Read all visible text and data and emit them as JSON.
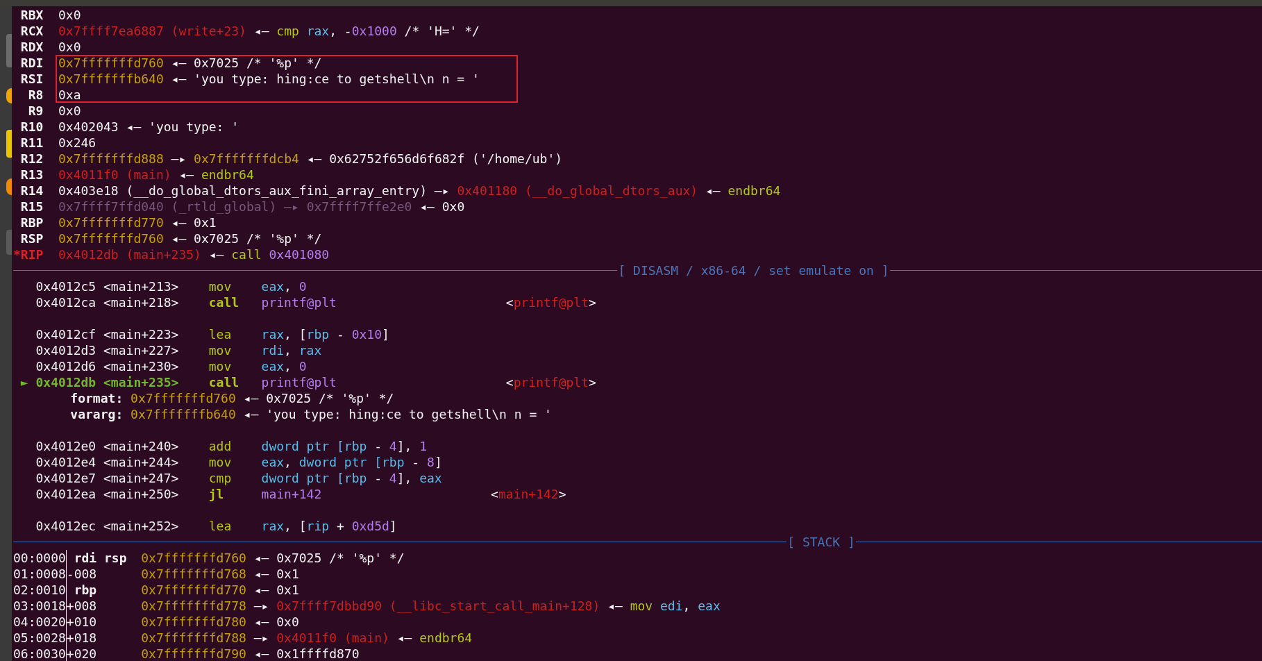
{
  "registers": [
    {
      "name": "RBX",
      "changed": false,
      "highlighted": false,
      "value": [
        {
          "text": "0x0",
          "kind": "plain"
        }
      ]
    },
    {
      "name": "RCX",
      "changed": false,
      "highlighted": false,
      "value": [
        {
          "text": "0x7ffff7ea6887 (write+23)",
          "kind": "code"
        },
        {
          "text": " ◂— ",
          "kind": "plain"
        },
        {
          "text": "cmp",
          "kind": "kw"
        },
        {
          "text": " rax",
          "kind": "reg"
        },
        {
          "text": ", -",
          "kind": "plain"
        },
        {
          "text": "0x1000",
          "kind": "num"
        },
        {
          "text": " /* 'H=' */",
          "kind": "plain"
        }
      ]
    },
    {
      "name": "RDX",
      "changed": false,
      "highlighted": false,
      "value": [
        {
          "text": "0x0",
          "kind": "plain"
        }
      ]
    },
    {
      "name": "RDI",
      "changed": false,
      "highlighted": true,
      "value": [
        {
          "text": "0x7fffffffd760",
          "kind": "stack"
        },
        {
          "text": " ◂— 0x7025 /* '%p' */",
          "kind": "plain"
        }
      ]
    },
    {
      "name": "RSI",
      "changed": false,
      "highlighted": true,
      "value": [
        {
          "text": "0x7fffffffb640",
          "kind": "stack"
        },
        {
          "text": " ◂— 'you type: hing:ce to getshell\\n n = '",
          "kind": "plain"
        }
      ]
    },
    {
      "name": "R8",
      "changed": false,
      "highlighted": true,
      "value": [
        {
          "text": "0xa",
          "kind": "plain"
        }
      ]
    },
    {
      "name": "R9",
      "changed": false,
      "highlighted": false,
      "value": [
        {
          "text": "0x0",
          "kind": "plain"
        }
      ]
    },
    {
      "name": "R10",
      "changed": false,
      "highlighted": false,
      "value": [
        {
          "text": "0x402043 ◂— 'you type: '",
          "kind": "plain"
        }
      ]
    },
    {
      "name": "R11",
      "changed": false,
      "highlighted": false,
      "value": [
        {
          "text": "0x246",
          "kind": "plain"
        }
      ]
    },
    {
      "name": "R12",
      "changed": false,
      "highlighted": false,
      "value": [
        {
          "text": "0x7fffffffd888",
          "kind": "stack"
        },
        {
          "text": " —▸ ",
          "kind": "plain"
        },
        {
          "text": "0x7fffffffdcb4",
          "kind": "stack"
        },
        {
          "text": " ◂— 0x62752f656d6f682f ('/home/ub')",
          "kind": "plain"
        }
      ]
    },
    {
      "name": "R13",
      "changed": false,
      "highlighted": false,
      "value": [
        {
          "text": "0x4011f0 (main)",
          "kind": "code"
        },
        {
          "text": " ◂— ",
          "kind": "plain"
        },
        {
          "text": "endbr64",
          "kind": "kw"
        }
      ]
    },
    {
      "name": "R14",
      "changed": false,
      "highlighted": false,
      "value": [
        {
          "text": "0x403e18 (__do_global_dtors_aux_fini_array_entry) —▸ ",
          "kind": "plain"
        },
        {
          "text": "0x401180 (__do_global_dtors_aux)",
          "kind": "code"
        },
        {
          "text": " ◂— ",
          "kind": "plain"
        },
        {
          "text": "endbr64",
          "kind": "kw"
        }
      ]
    },
    {
      "name": "R15",
      "changed": false,
      "highlighted": false,
      "value": [
        {
          "text": "0x7ffff7ffd040 (_rtld_global) —▸ 0x7ffff7ffe2e0",
          "kind": "dim"
        },
        {
          "text": " ◂— 0x0",
          "kind": "plain"
        }
      ]
    },
    {
      "name": "RBP",
      "changed": false,
      "highlighted": false,
      "value": [
        {
          "text": "0x7fffffffd770",
          "kind": "stack"
        },
        {
          "text": " ◂— 0x1",
          "kind": "plain"
        }
      ]
    },
    {
      "name": "RSP",
      "changed": false,
      "highlighted": false,
      "value": [
        {
          "text": "0x7fffffffd760",
          "kind": "stack"
        },
        {
          "text": " ◂— 0x7025 /* '%p' */",
          "kind": "plain"
        }
      ]
    },
    {
      "name": "*RIP",
      "changed": true,
      "highlighted": false,
      "value": [
        {
          "text": "0x4012db (main+235)",
          "kind": "code"
        },
        {
          "text": " ◂— ",
          "kind": "plain"
        },
        {
          "text": "call",
          "kind": "kw"
        },
        {
          "text": " 0x401080",
          "kind": "num"
        }
      ]
    }
  ],
  "disasm_header": "[ DISASM / x86-64 / set emulate on ]",
  "disasm": [
    {
      "kind": "insn",
      "current": false,
      "address": "0x4012c5",
      "symbol": "<main+213>",
      "mnemonic": "mov",
      "branch": false,
      "operands": [
        {
          "text": "eax",
          "kind": "reg"
        },
        {
          "text": ", ",
          "kind": "plain"
        },
        {
          "text": "0",
          "kind": "num"
        }
      ]
    },
    {
      "kind": "insn",
      "current": false,
      "address": "0x4012ca",
      "symbol": "<main+218>",
      "mnemonic": "call",
      "branch": true,
      "operands": [
        {
          "text": "printf@plt",
          "kind": "num"
        }
      ],
      "target": [
        {
          "text": "<",
          "kind": "plain"
        },
        {
          "text": "printf@plt",
          "kind": "code"
        },
        {
          "text": ">",
          "kind": "plain"
        }
      ]
    },
    {
      "kind": "blank"
    },
    {
      "kind": "insn",
      "current": false,
      "address": "0x4012cf",
      "symbol": "<main+223>",
      "mnemonic": "lea",
      "branch": false,
      "operands": [
        {
          "text": "rax",
          "kind": "reg"
        },
        {
          "text": ", [",
          "kind": "plain"
        },
        {
          "text": "rbp",
          "kind": "reg"
        },
        {
          "text": " - ",
          "kind": "plain"
        },
        {
          "text": "0x10",
          "kind": "num"
        },
        {
          "text": "]",
          "kind": "plain"
        }
      ]
    },
    {
      "kind": "insn",
      "current": false,
      "address": "0x4012d3",
      "symbol": "<main+227>",
      "mnemonic": "mov",
      "branch": false,
      "operands": [
        {
          "text": "rdi",
          "kind": "reg"
        },
        {
          "text": ", ",
          "kind": "plain"
        },
        {
          "text": "rax",
          "kind": "reg"
        }
      ]
    },
    {
      "kind": "insn",
      "current": false,
      "address": "0x4012d6",
      "symbol": "<main+230>",
      "mnemonic": "mov",
      "branch": false,
      "operands": [
        {
          "text": "eax",
          "kind": "reg"
        },
        {
          "text": ", ",
          "kind": "plain"
        },
        {
          "text": "0",
          "kind": "num"
        }
      ]
    },
    {
      "kind": "insn",
      "current": true,
      "pointer": "►",
      "address": "0x4012db",
      "symbol": "<main+235>",
      "mnemonic": "call",
      "branch": true,
      "operands": [
        {
          "text": "printf@plt",
          "kind": "num"
        }
      ],
      "target": [
        {
          "text": "<",
          "kind": "plain"
        },
        {
          "text": "printf@plt",
          "kind": "code"
        },
        {
          "text": ">",
          "kind": "plain"
        }
      ]
    },
    {
      "kind": "arg",
      "label": "format:",
      "value": [
        {
          "text": "0x7fffffffd760",
          "kind": "stack"
        },
        {
          "text": " ◂— 0x7025 /* '%p' */",
          "kind": "plain"
        }
      ]
    },
    {
      "kind": "arg",
      "label": "vararg:",
      "value": [
        {
          "text": "0x7fffffffb640",
          "kind": "stack"
        },
        {
          "text": " ◂— 'you type: hing:ce to getshell\\n n = '",
          "kind": "plain"
        }
      ]
    },
    {
      "kind": "blank"
    },
    {
      "kind": "insn",
      "current": false,
      "address": "0x4012e0",
      "symbol": "<main+240>",
      "mnemonic": "add",
      "branch": false,
      "operands": [
        {
          "text": "dword ptr [",
          "kind": "reg"
        },
        {
          "text": "rbp",
          "kind": "reg"
        },
        {
          "text": " - ",
          "kind": "plain"
        },
        {
          "text": "4",
          "kind": "num"
        },
        {
          "text": "], ",
          "kind": "plain"
        },
        {
          "text": "1",
          "kind": "num"
        }
      ]
    },
    {
      "kind": "insn",
      "current": false,
      "address": "0x4012e4",
      "symbol": "<main+244>",
      "mnemonic": "mov",
      "branch": false,
      "operands": [
        {
          "text": "eax",
          "kind": "reg"
        },
        {
          "text": ", ",
          "kind": "plain"
        },
        {
          "text": "dword ptr [",
          "kind": "reg"
        },
        {
          "text": "rbp",
          "kind": "reg"
        },
        {
          "text": " - ",
          "kind": "plain"
        },
        {
          "text": "8",
          "kind": "num"
        },
        {
          "text": "]",
          "kind": "plain"
        }
      ]
    },
    {
      "kind": "insn",
      "current": false,
      "address": "0x4012e7",
      "symbol": "<main+247>",
      "mnemonic": "cmp",
      "branch": false,
      "operands": [
        {
          "text": "dword ptr [",
          "kind": "reg"
        },
        {
          "text": "rbp",
          "kind": "reg"
        },
        {
          "text": " - ",
          "kind": "plain"
        },
        {
          "text": "4",
          "kind": "num"
        },
        {
          "text": "], ",
          "kind": "plain"
        },
        {
          "text": "eax",
          "kind": "reg"
        }
      ]
    },
    {
      "kind": "insn",
      "current": false,
      "address": "0x4012ea",
      "symbol": "<main+250>",
      "mnemonic": "jl",
      "branch": true,
      "operands": [
        {
          "text": "main+142",
          "kind": "num"
        }
      ],
      "target": [
        {
          "text": "<",
          "kind": "plain"
        },
        {
          "text": "main+142",
          "kind": "code"
        },
        {
          "text": ">",
          "kind": "plain"
        }
      ]
    },
    {
      "kind": "blank"
    },
    {
      "kind": "insn",
      "current": false,
      "address": "0x4012ec",
      "symbol": "<main+252>",
      "mnemonic": "lea",
      "branch": false,
      "operands": [
        {
          "text": "rax",
          "kind": "reg"
        },
        {
          "text": ", [",
          "kind": "plain"
        },
        {
          "text": "rip",
          "kind": "reg"
        },
        {
          "text": " + ",
          "kind": "plain"
        },
        {
          "text": "0xd5d",
          "kind": "num"
        },
        {
          "text": "]",
          "kind": "plain"
        }
      ]
    }
  ],
  "stack_header": "[ STACK ]",
  "stack": [
    {
      "index": "00:0000",
      "tag": {
        "text": "rdi rsp",
        "kind": "bold"
      },
      "value": [
        {
          "text": "0x7fffffffd760",
          "kind": "stack"
        },
        {
          "text": " ◂— 0x7025 /* '%p' */",
          "kind": "plain"
        }
      ]
    },
    {
      "index": "01:0008",
      "tag": {
        "text": "-008",
        "kind": "plain"
      },
      "value": [
        {
          "text": "0x7fffffffd768",
          "kind": "stack"
        },
        {
          "text": " ◂— 0x1",
          "kind": "plain"
        }
      ]
    },
    {
      "index": "02:0010",
      "tag": {
        "text": "rbp",
        "kind": "bold"
      },
      "value": [
        {
          "text": "0x7fffffffd770",
          "kind": "stack"
        },
        {
          "text": " ◂— 0x1",
          "kind": "plain"
        }
      ]
    },
    {
      "index": "03:0018",
      "tag": {
        "text": "+008",
        "kind": "plain"
      },
      "value": [
        {
          "text": "0x7fffffffd778",
          "kind": "stack"
        },
        {
          "text": " —▸ ",
          "kind": "plain"
        },
        {
          "text": "0x7ffff7dbbd90 (__libc_start_call_main+128)",
          "kind": "code"
        },
        {
          "text": " ◂— ",
          "kind": "plain"
        },
        {
          "text": "mov",
          "kind": "kw"
        },
        {
          "text": " edi",
          "kind": "reg"
        },
        {
          "text": ", ",
          "kind": "plain"
        },
        {
          "text": "eax",
          "kind": "reg"
        }
      ]
    },
    {
      "index": "04:0020",
      "tag": {
        "text": "+010",
        "kind": "plain"
      },
      "value": [
        {
          "text": "0x7fffffffd780",
          "kind": "stack"
        },
        {
          "text": " ◂— 0x0",
          "kind": "plain"
        }
      ]
    },
    {
      "index": "05:0028",
      "tag": {
        "text": "+018",
        "kind": "plain"
      },
      "value": [
        {
          "text": "0x7fffffffd788",
          "kind": "stack"
        },
        {
          "text": " —▸ ",
          "kind": "plain"
        },
        {
          "text": "0x4011f0 (main)",
          "kind": "code"
        },
        {
          "text": " ◂— ",
          "kind": "plain"
        },
        {
          "text": "endbr64",
          "kind": "kw"
        }
      ]
    },
    {
      "index": "06:0030",
      "tag": {
        "text": "+020",
        "kind": "plain"
      },
      "value": [
        {
          "text": "0x7fffffffd790",
          "kind": "stack"
        },
        {
          "text": " ◂— 0x1ffffd870",
          "kind": "plain"
        }
      ]
    }
  ]
}
